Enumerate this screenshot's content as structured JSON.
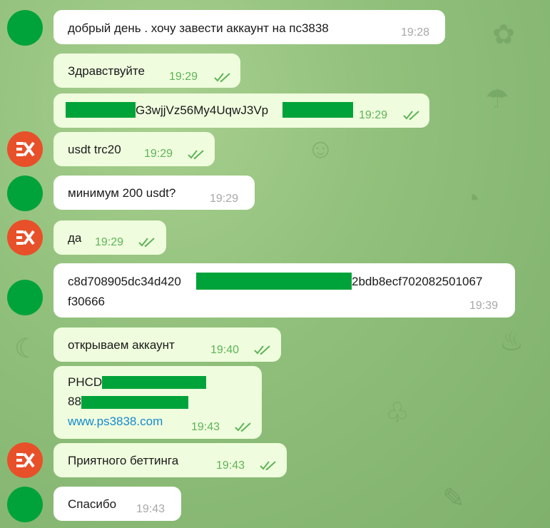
{
  "messages": [
    {
      "sender": "client",
      "text": "добрый  день  . хочу  завести аккаунт  на пс3838",
      "time": "19:28"
    },
    {
      "sender": "agent",
      "text": "Здравствуйте",
      "time": "19:29"
    },
    {
      "sender": "agent",
      "text_visible": "G3wjjVz56My4UqwJ3Vp",
      "time": "19:29"
    },
    {
      "sender": "agent",
      "text": "usdt trc20",
      "time": "19:29"
    },
    {
      "sender": "client",
      "text": "минимум 200 usdt?",
      "time": "19:29"
    },
    {
      "sender": "agent",
      "text": "да",
      "time": "19:29"
    },
    {
      "sender": "client",
      "text_start": "c8d708905dc34d420",
      "text_end": "2bdb8ecf702082501067",
      "text_line2": "f30666",
      "time": "19:39"
    },
    {
      "sender": "agent",
      "text": "открываем аккаунт",
      "time": "19:40"
    },
    {
      "sender": "agent",
      "line1": "PHCD",
      "line2": "88",
      "link": "www.ps3838.com",
      "time": "19:43"
    },
    {
      "sender": "agent",
      "text": "Приятного беттинга",
      "time": "19:43"
    },
    {
      "sender": "client",
      "text": "Спасибо",
      "time": "19:43"
    }
  ],
  "colors": {
    "incoming_bubble": "#ffffff",
    "outgoing_bubble": "#effdde",
    "outgoing_time": "#5fb357",
    "incoming_time": "#a7a7a7",
    "link": "#168acd",
    "redaction": "#00a339",
    "client_avatar": "#00a33a",
    "agent_avatar": "#e8502a"
  },
  "icons": {
    "read_receipt": "double-check-icon",
    "agent_avatar": "brand-logo-icon"
  }
}
